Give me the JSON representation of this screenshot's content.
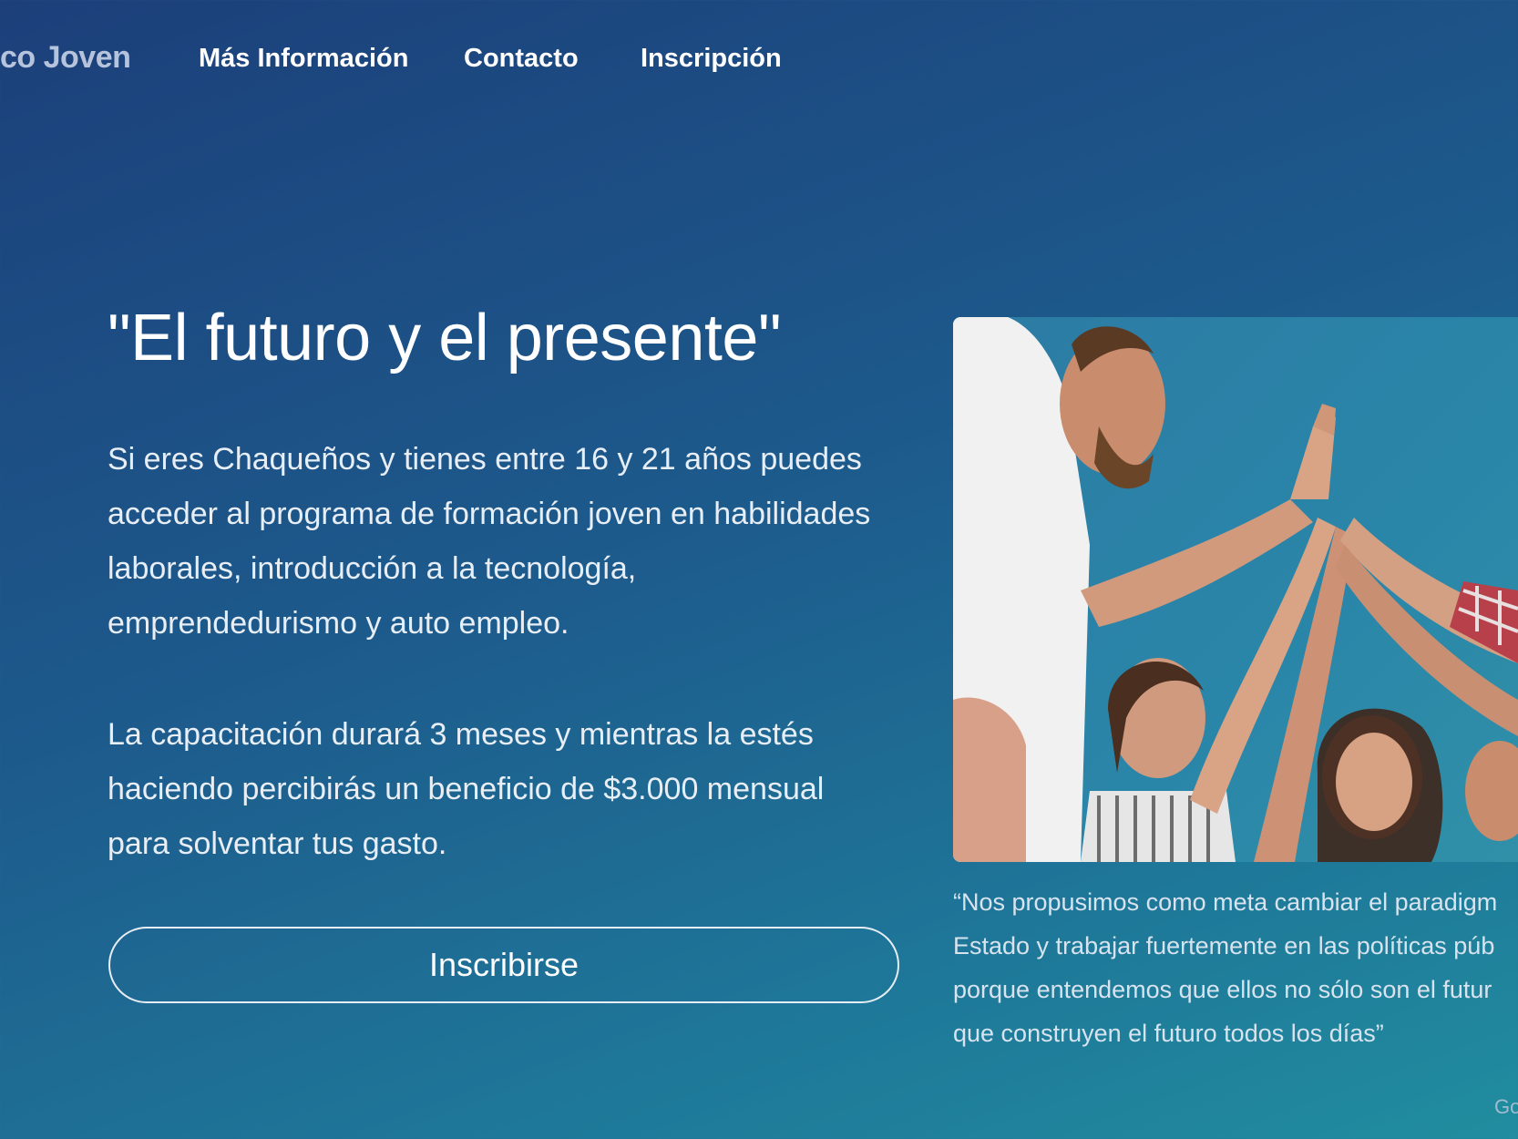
{
  "nav": {
    "brand": "co Joven",
    "links": [
      {
        "label": "Más Información"
      },
      {
        "label": "Contacto"
      },
      {
        "label": "Inscripción"
      }
    ]
  },
  "hero": {
    "title": "\"El futuro y el presente\"",
    "paragraph_1": "Si eres Chaqueños y tienes entre 16 y 21 años puedes acceder al programa de formación joven en habilidades laborales, introducción a la tecnología, emprendedurismo y auto empleo.",
    "paragraph_2": "La capacitación durará 3 meses y mientras la estés haciendo percibirás un beneficio de $3.000 mensual para solventar tus gasto.",
    "cta_label": "Inscribirse"
  },
  "quote": {
    "text": "“Nos propusimos como meta cambiar el paradigm\nEstado y trabajar fuertemente en las políticas púb\nporque entendemos que ellos no sólo son el futur\nque construyen el futuro todos los días”"
  },
  "footer": {
    "corner_text": "Go"
  },
  "colors": {
    "gradient_start": "#1c3f7a",
    "gradient_end": "#218d9f",
    "text": "#ffffff",
    "brand_text": "#b6c3dc"
  }
}
